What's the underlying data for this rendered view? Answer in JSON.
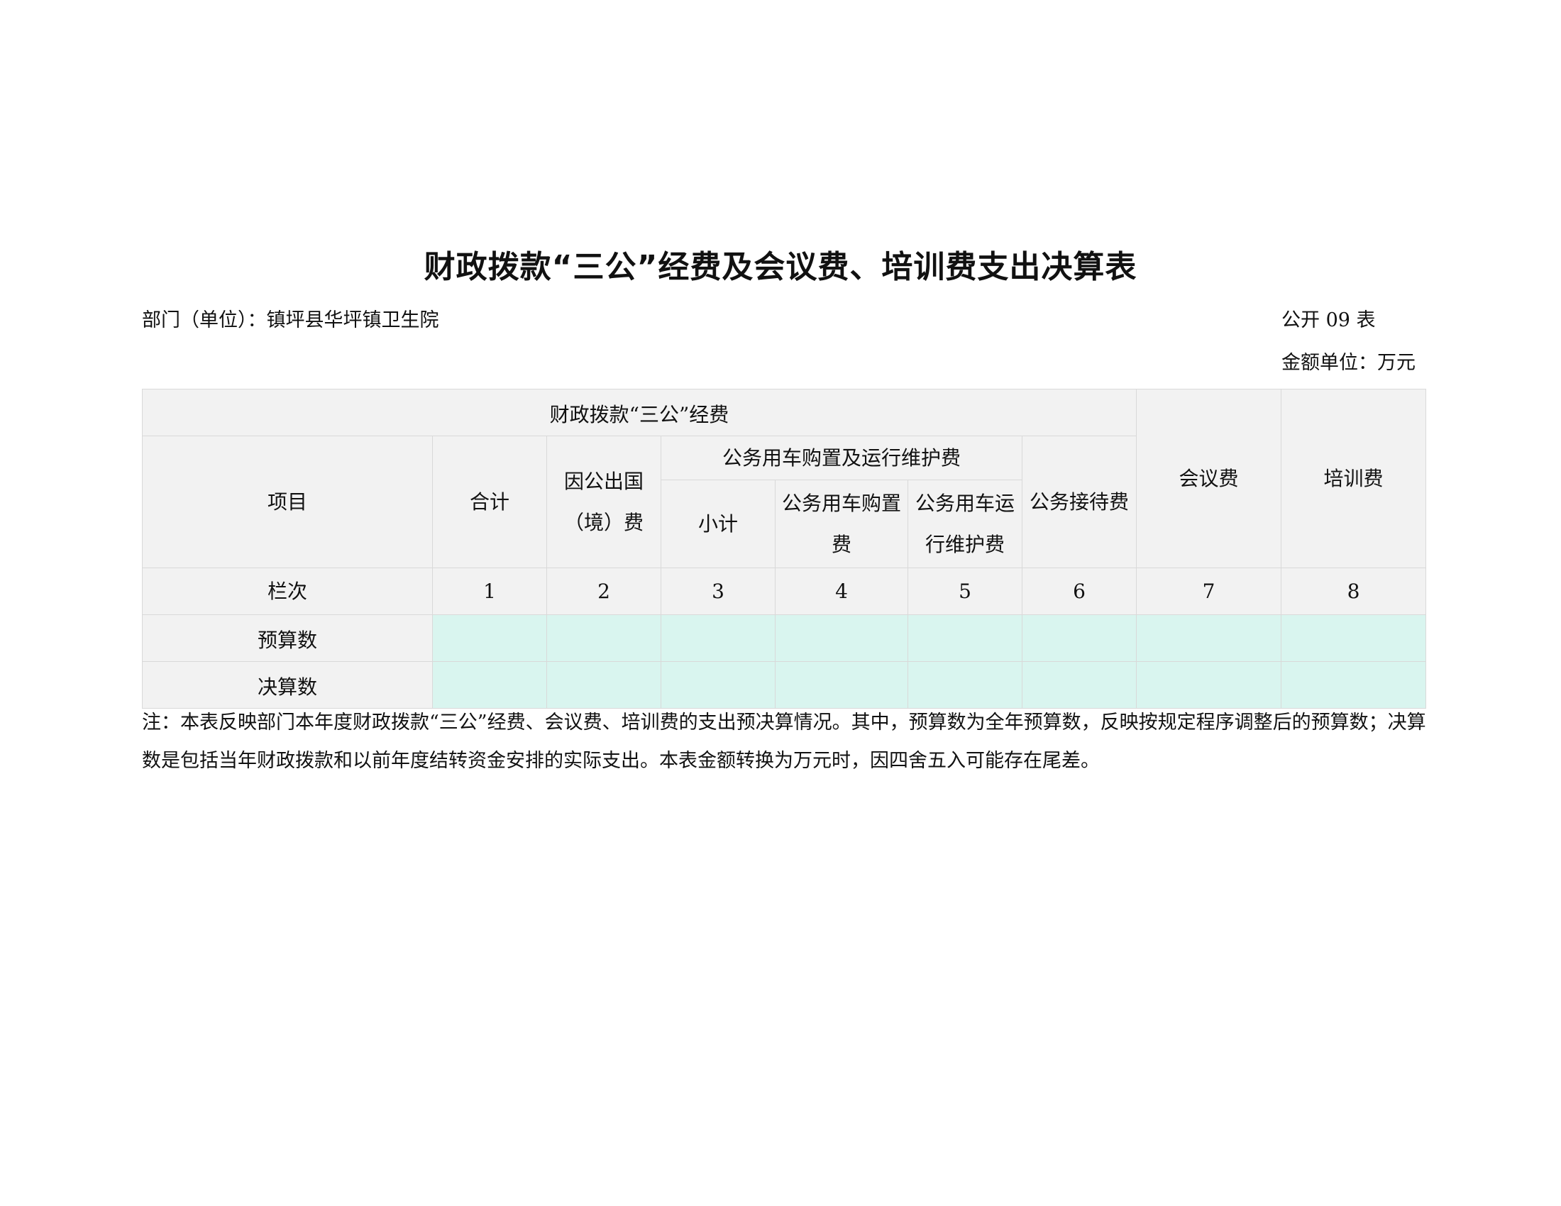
{
  "title": "财政拨款“三公”经费及会议费、培训费支出决算表",
  "department": {
    "label": "部门（单位）：镇坪县华坪镇卫生院"
  },
  "form_number": "公开 09 表",
  "unit": "金额单位：万元",
  "table": {
    "group_header": "财政拨款“三公”经费",
    "item_header": "项目",
    "total_header": "合计",
    "overseas_header": "因公出国（境）费",
    "vehicle_group_header": "公务用车购置及运行维护费",
    "vehicle_subtotal_header": "小计",
    "vehicle_purchase_header": "公务用车购置费",
    "vehicle_operation_header": "公务用车运行维护费",
    "reception_header": "公务接待费",
    "meeting_header": "会议费",
    "training_header": "培训费",
    "column_label": "栏次",
    "column_numbers": [
      "1",
      "2",
      "3",
      "4",
      "5",
      "6",
      "7",
      "8"
    ],
    "rows": [
      {
        "label": "预算数",
        "values": [
          "",
          "",
          "",
          "",
          "",
          "",
          "",
          ""
        ]
      },
      {
        "label": "决算数",
        "values": [
          "",
          "",
          "",
          "",
          "",
          "",
          "",
          ""
        ]
      }
    ]
  },
  "note": "注：本表反映部门本年度财政拨款“三公”经费、会议费、培训费的支出预决算情况。其中，预算数为全年预算数，反映按规定程序调整后的预算数；决算数是包括当年财政拨款和以前年度结转资金安排的实际支出。本表金额转换为万元时，因四舍五入可能存在尾差。",
  "colors": {
    "header_bg": "#f2f2f2",
    "data_bg": "#d9f5ef",
    "border": "#d9d9d9"
  }
}
